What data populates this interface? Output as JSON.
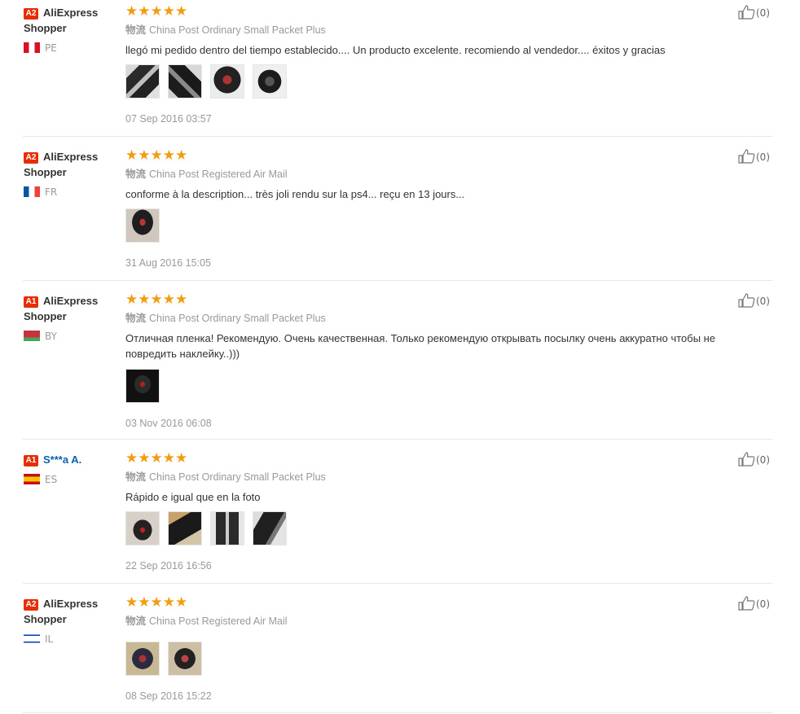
{
  "reviews": [
    {
      "level": "A2",
      "name_line1": "AliExpress",
      "name_line2": "Shopper",
      "country": "PE",
      "stars": "★★★★★",
      "shipping_label": "物流",
      "shipping": "China Post Ordinary Small Packet Plus",
      "text": "llegó mi pedido dentro del tiempo establecido.... Un producto excelente. recomiendo al vendedor.... éxitos y gracias",
      "date": "07 Sep 2016 03:57",
      "likes": "(0)"
    },
    {
      "level": "A2",
      "name_line1": "AliExpress",
      "name_line2": "Shopper",
      "country": "FR",
      "stars": "★★★★★",
      "shipping_label": "物流",
      "shipping": "China Post Registered Air Mail",
      "text": "conforme à la description... très joli rendu sur la ps4... reçu en 13 jours...",
      "date": "31 Aug 2016 15:05",
      "likes": "(0)"
    },
    {
      "level": "A1",
      "name_line1": "AliExpress",
      "name_line2": "Shopper",
      "country": "BY",
      "stars": "★★★★★",
      "shipping_label": "物流",
      "shipping": "China Post Ordinary Small Packet Plus",
      "text": "Отличная пленка! Рекомендую. Очень качественная. Только рекомендую открывать посылку очень аккуратно чтобы не повредить наклейку..)))",
      "date": "03 Nov 2016 06:08",
      "likes": "(0)"
    },
    {
      "level": "A1",
      "name_line1": "S***a A.",
      "name_line2": "",
      "country": "ES",
      "stars": "★★★★★",
      "shipping_label": "物流",
      "shipping": "China Post Ordinary Small Packet Plus",
      "text": "Rápido e igual que en la foto",
      "date": "22 Sep 2016 16:56",
      "likes": "(0)"
    },
    {
      "level": "A2",
      "name_line1": "AliExpress",
      "name_line2": "Shopper",
      "country": "IL",
      "stars": "★★★★★",
      "shipping_label": "物流",
      "shipping": "China Post Registered Air Mail",
      "text": "",
      "date": "08 Sep 2016 15:22",
      "likes": "(0)"
    }
  ],
  "colors": {
    "star": "#f39c12",
    "badge": "#e62e04",
    "link": "#0a60ad",
    "muted": "#999999"
  },
  "icons": {
    "like": "thumbs-up-icon"
  }
}
